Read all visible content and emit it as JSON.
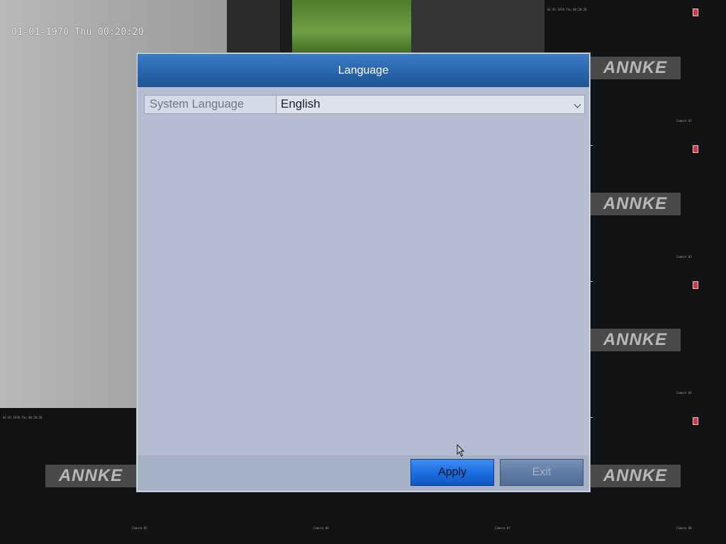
{
  "osd": {
    "timestamp": "01-01-1970 Thu 00:20:20"
  },
  "brand": {
    "logo_text": "ANNKE"
  },
  "dialog": {
    "title": "Language",
    "rows": [
      {
        "label": "System Language",
        "value": "English"
      }
    ],
    "buttons": {
      "apply": "Apply",
      "exit": "Exit"
    }
  },
  "colors": {
    "title_bar": "#2a67ad",
    "dialog_body": "#b4bdd2",
    "apply_button": "#1b6ee2",
    "exit_button": "#5f7ca6",
    "record_indicator": "#d13a4b"
  },
  "icons": {
    "dropdown": "chevron-down-icon",
    "pointer": "mouse-cursor-icon"
  }
}
